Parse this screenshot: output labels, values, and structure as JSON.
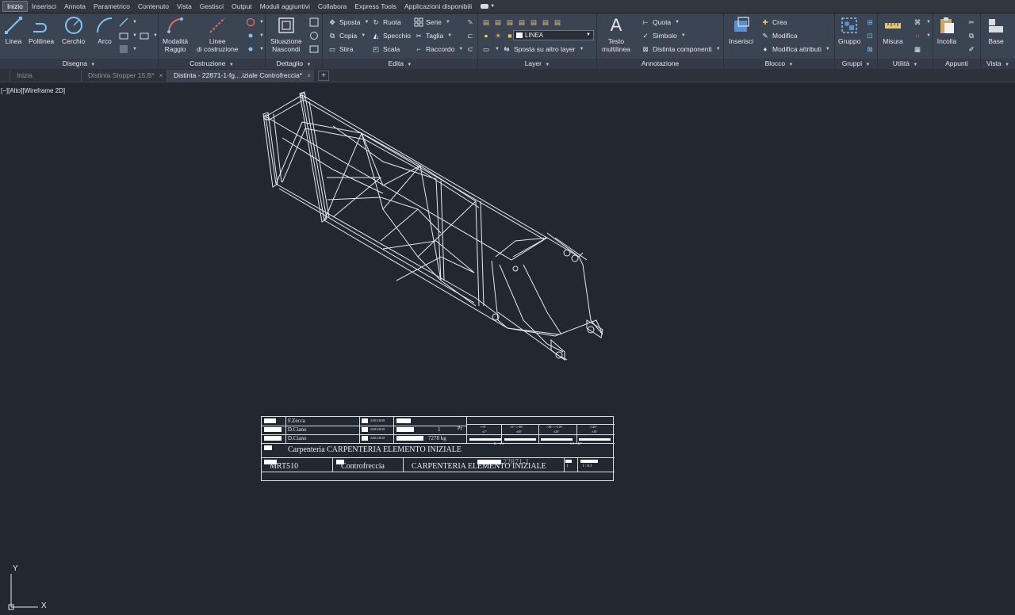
{
  "ribbon_tabs": [
    "Inizio",
    "Inserisci",
    "Annota",
    "Parametrico",
    "Contenuto",
    "Vista",
    "Gestisci",
    "Output",
    "Moduli aggiuntivi",
    "Collabora",
    "Express Tools",
    "Applicazioni disponibili"
  ],
  "panels": {
    "disegna": {
      "title": "Disegna",
      "linea": "Linea",
      "polilinea": "Polilinea",
      "cerchio": "Cerchio",
      "arco": "Arco"
    },
    "costruzione": {
      "title": "Costruzione",
      "modalita_raggio": [
        "Modalità",
        "Raggio"
      ],
      "linee_costruzione": [
        "Linee",
        "di costruzione"
      ]
    },
    "dettaglio": {
      "title": "Dettaglio",
      "situazione_nascondi": [
        "Situazione",
        "Nascondi"
      ]
    },
    "edita": {
      "title": "Edita",
      "sposta": "Sposta",
      "ruota": "Ruota",
      "serie": "Serie",
      "copia": "Copia",
      "specchio": "Specchio",
      "taglia": "Taglia",
      "stira": "Stira",
      "scala": "Scala",
      "raccordo": "Raccordo"
    },
    "layer": {
      "title": "Layer",
      "current_layer": "LINEA",
      "sposta_altro_layer": "Sposta su altro layer"
    },
    "annotazione": {
      "title": "Annotazione",
      "testo_multilinea": [
        "Testo",
        "multilinea"
      ],
      "quota": "Quota",
      "simbolo": "Simbolo",
      "distinta_componenti": "Distinta componenti"
    },
    "blocco": {
      "title": "Blocco",
      "inserisci": "Inserisci",
      "crea": "Crea",
      "modifica": "Modifica",
      "modifica_attributi": "Modifica attributi"
    },
    "gruppi": {
      "title": "Gruppi",
      "gruppo": "Gruppo"
    },
    "utilita": {
      "title": "Utilità",
      "misura": "Misura"
    },
    "appunti": {
      "title": "Appunti",
      "incolla": "Incolla"
    },
    "vista": {
      "title": "Vista",
      "base": "Base"
    }
  },
  "doc_tabs": [
    {
      "label": "Inizia",
      "active": false
    },
    {
      "label": "Distinta Stopper 15.B*",
      "active": false
    },
    {
      "label": "Distinta - 22871-1-fg....iziale Controfreccia*",
      "active": true
    }
  ],
  "viewport_label": "[−][Alto][Wireframe 2D]",
  "title_block": {
    "names": [
      "F.Zecca",
      "D.Ciano",
      "D.Ciano"
    ],
    "dates": [
      "23/01/2018",
      "24/01/2018",
      "24/01/2018"
    ],
    "quantity": "1",
    "quantity_unit": "Pz",
    "weight": "7278 kg",
    "tolerances_header": [
      "<=6°",
      ">6° <=30°",
      ">30° <=119°",
      ">120°"
    ],
    "tolerances_values": [
      "±1°",
      "±30'",
      "±20'",
      "±10'"
    ],
    "tolerance_notes": [
      "R = 0.4",
      "0.5 × 45°"
    ],
    "description": "Carpenteria CARPENTERIA ELEMENTO INIZIALE",
    "code": "MRT510",
    "subtitle": "Controfreccia",
    "drawing_title": "CARPENTERIA ELEMENTO INIZIALE",
    "drawing_number": "22871-1",
    "sheet": "1",
    "scale": "1 : 0.1"
  },
  "ucs": {
    "x": "X",
    "y": "Y"
  },
  "colors": {
    "ribbon_bg": "#3b4453",
    "canvas_bg": "#212830",
    "drawing_lines": "#e6e9ec"
  }
}
